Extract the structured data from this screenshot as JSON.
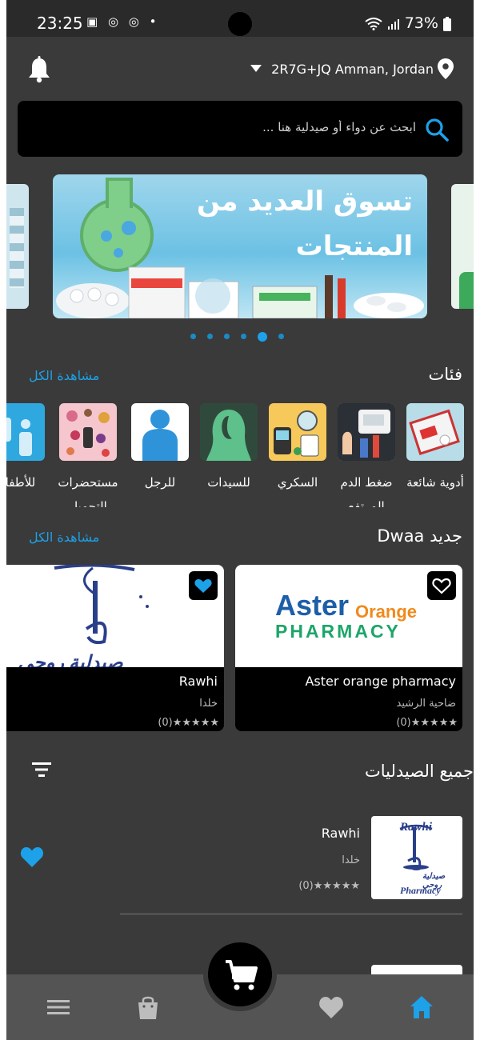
{
  "status_bar": {
    "time": "23:25",
    "left_icons": "▣ ◎ ◎ •",
    "battery": "73%"
  },
  "header": {
    "location": "2R7G+JQ Amman, Jordan"
  },
  "search": {
    "placeholder": "ابحث عن دواء أو صيدلية هنا ..."
  },
  "banner": {
    "headline": "تسوق العديد من المنتجات",
    "slide_count": 6,
    "active_slide": 5
  },
  "categories_section": {
    "title": "فئات",
    "see_all": "مشاهدة الكل",
    "items": [
      {
        "label": "أدوية شائعة"
      },
      {
        "label": "ضغط الدم المرتفع"
      },
      {
        "label": "السكري"
      },
      {
        "label": "للسيدات"
      },
      {
        "label": "للرجل"
      },
      {
        "label": "مستحضرات التجميل"
      },
      {
        "label": "للأطفال"
      }
    ]
  },
  "new_section": {
    "title": "جديد Dwaa",
    "see_all": "مشاهدة الكل",
    "cards": [
      {
        "name": "Aster orange pharmacy",
        "area": "ضاحية الرشيد",
        "rating": "(0)★★★★★",
        "logo_main": "Aster",
        "logo_accent": "Orange",
        "logo_sub": "PHARMACY",
        "favorite": false
      },
      {
        "name": "Rawhi",
        "area": "خلدا",
        "rating": "(0)★★★★★",
        "logo_text": "صيدلية روحي",
        "favorite": true
      }
    ]
  },
  "all_pharmacies": {
    "title": "جميع الصيدليات",
    "items": [
      {
        "name": "Rawhi",
        "area": "خلدا",
        "rating": "(0)★★★★★",
        "logo_line1": "Rawhi",
        "logo_line2": "Pharmacy",
        "logo_arabic": "صيدلية روحي",
        "favorite": true
      }
    ]
  },
  "colors": {
    "background": "#3a3a3a",
    "accent": "#1da1e8",
    "card": "#000000",
    "nav": "#545454"
  },
  "bottom_nav": {
    "items": [
      "menu-icon",
      "bag-icon",
      "cart-icon",
      "heart-icon",
      "home-icon"
    ],
    "active": "home-icon"
  }
}
